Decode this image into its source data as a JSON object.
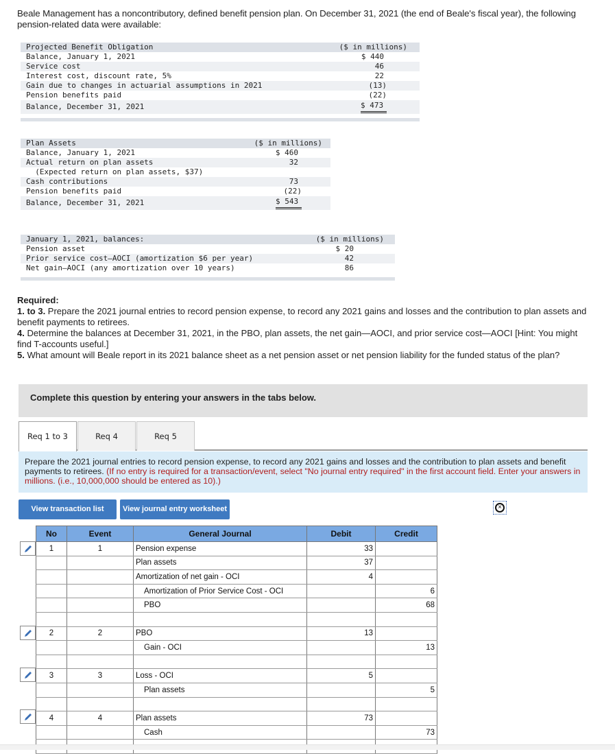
{
  "intro": "Beale Management has a noncontributory, defined benefit pension plan. On December 31, 2021 (the end of Beale's fiscal year), the following pension-related data were available:",
  "pbo": {
    "title": "Projected Benefit Obligation",
    "unit": "($ in millions)",
    "rows": [
      {
        "label": "Balance, January 1, 2021",
        "value": "$ 440"
      },
      {
        "label": "Service cost",
        "value": "46"
      },
      {
        "label": "Interest cost, discount rate, 5%",
        "value": "22"
      },
      {
        "label": "Gain due to changes in actuarial assumptions in 2021",
        "value": "(13)"
      },
      {
        "label": "Pension benefits paid",
        "value": "(22)"
      },
      {
        "label": "Balance, December 31, 2021",
        "value": "$ 473"
      }
    ]
  },
  "plan_assets": {
    "title": "Plan Assets",
    "unit": "($ in millions)",
    "rows": [
      {
        "label": "Balance, January 1, 2021",
        "value": "$ 460"
      },
      {
        "label": "Actual return on plan assets",
        "value": "32"
      },
      {
        "label": "  (Expected return on plan assets, $37)",
        "value": ""
      },
      {
        "label": "Cash contributions",
        "value": "73"
      },
      {
        "label": "Pension benefits paid",
        "value": "(22)"
      },
      {
        "label": "Balance, December 31, 2021",
        "value": "$ 543"
      }
    ]
  },
  "balances": {
    "title": "January 1, 2021, balances:",
    "unit": "($ in millions)",
    "rows": [
      {
        "label": "Pension asset",
        "value": "$ 20"
      },
      {
        "label": "Prior service cost—AOCI (amortization $6 per year)",
        "value": "42"
      },
      {
        "label": "Net gain—AOCI (any amortization over 10 years)",
        "value": "86"
      }
    ]
  },
  "required": {
    "heading": "Required:",
    "items": [
      {
        "num": "1. to 3.",
        "text": " Prepare the 2021 journal entries to record pension expense, to record any 2021 gains and losses and the contribution to plan assets and benefit payments to retirees."
      },
      {
        "num": "4.",
        "text": " Determine the balances at December 31, 2021, in the PBO, plan assets, the net gain—AOCI, and prior service cost—AOCI [Hint: You might find T-accounts useful.]"
      },
      {
        "num": "5.",
        "text": " What amount will Beale report in its 2021 balance sheet as a net pension asset or net pension liability for the funded status of the plan?"
      }
    ]
  },
  "complete_bar": "Complete this question by entering your answers in the tabs below.",
  "tabs": [
    "Req 1 to 3",
    "Req 4",
    "Req 5"
  ],
  "instructions": {
    "main": "Prepare the 2021 journal entries to record pension expense, to record any 2021 gains and losses and the contribution to plan assets and benefit payments to retirees. ",
    "red": "(If no entry is required for a transaction/event, select \"No journal entry required\" in the first account field. Enter your answers in millions. (i.e., 10,000,000 should be entered as 10).)"
  },
  "buttons": {
    "transaction_list": "View transaction list",
    "journal_worksheet": "View journal entry worksheet"
  },
  "journal": {
    "headers": [
      "No",
      "Event",
      "General Journal",
      "Debit",
      "Credit"
    ],
    "rows": [
      {
        "no": "1",
        "event": "1",
        "account": "Pension expense",
        "indent": false,
        "debit": "33",
        "credit": ""
      },
      {
        "no": "",
        "event": "",
        "account": "Plan assets",
        "indent": false,
        "debit": "37",
        "credit": ""
      },
      {
        "no": "",
        "event": "",
        "account": "Amortization of net gain - OCI",
        "indent": false,
        "debit": "4",
        "credit": ""
      },
      {
        "no": "",
        "event": "",
        "account": "Amortization of Prior Service Cost - OCI",
        "indent": true,
        "debit": "",
        "credit": "6"
      },
      {
        "no": "",
        "event": "",
        "account": "PBO",
        "indent": true,
        "debit": "",
        "credit": "68"
      },
      {
        "no": "",
        "event": "",
        "account": "",
        "indent": false,
        "debit": "",
        "credit": ""
      },
      {
        "no": "2",
        "event": "2",
        "account": "PBO",
        "indent": false,
        "debit": "13",
        "credit": ""
      },
      {
        "no": "",
        "event": "",
        "account": "Gain - OCI",
        "indent": true,
        "debit": "",
        "credit": "13"
      },
      {
        "no": "",
        "event": "",
        "account": "",
        "indent": false,
        "debit": "",
        "credit": ""
      },
      {
        "no": "3",
        "event": "3",
        "account": "Loss - OCI",
        "indent": false,
        "debit": "5",
        "credit": ""
      },
      {
        "no": "",
        "event": "",
        "account": "Plan assets",
        "indent": true,
        "debit": "",
        "credit": "5"
      },
      {
        "no": "",
        "event": "",
        "account": "",
        "indent": false,
        "debit": "",
        "credit": ""
      },
      {
        "no": "4",
        "event": "4",
        "account": "Plan assets",
        "indent": false,
        "debit": "73",
        "credit": ""
      },
      {
        "no": "",
        "event": "",
        "account": "Cash",
        "indent": true,
        "debit": "",
        "credit": "73"
      },
      {
        "no": "",
        "event": "",
        "account": "",
        "indent": false,
        "debit": "",
        "credit": ""
      }
    ]
  }
}
